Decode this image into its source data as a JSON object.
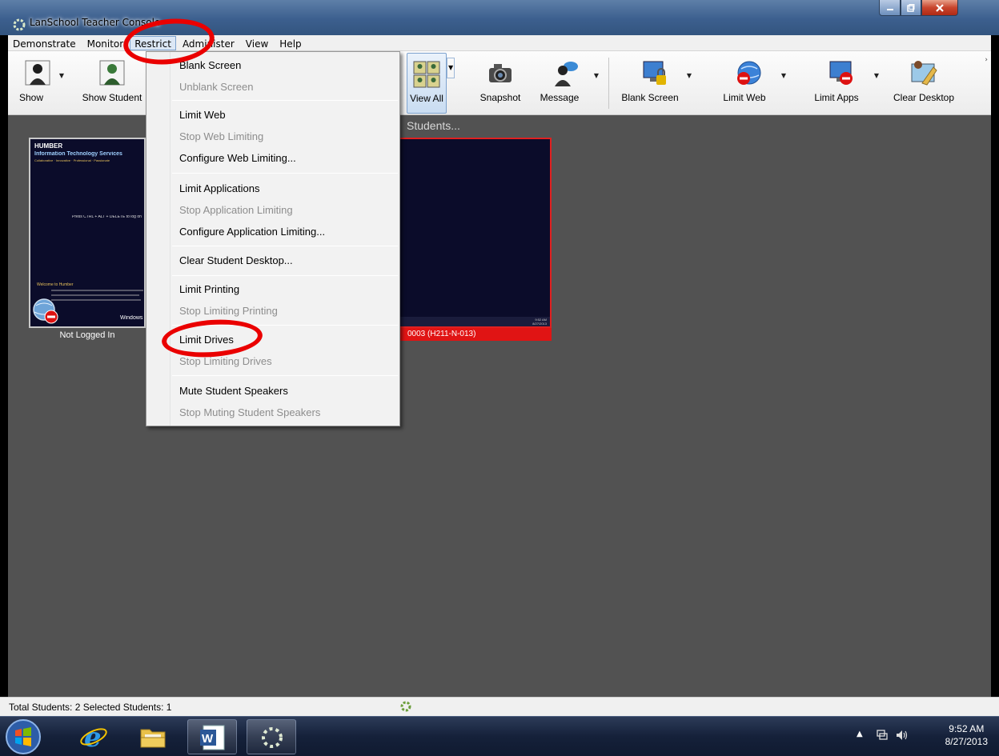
{
  "window": {
    "title": "LanSchool Teacher Console",
    "controls": {
      "minimize": "minimize",
      "maximize": "maximize",
      "close": "close"
    }
  },
  "menubar": [
    {
      "label": "Demonstrate"
    },
    {
      "label": "Monitor"
    },
    {
      "label": "Restrict",
      "active": true
    },
    {
      "label": "Administer"
    },
    {
      "label": "View"
    },
    {
      "label": "Help"
    }
  ],
  "toolbar": {
    "show": "Show",
    "show_student": "Show Student",
    "view_all": "View All",
    "snapshot": "Snapshot",
    "message": "Message",
    "blank_screen": "Blank Screen",
    "limit_web": "Limit Web",
    "limit_apps": "Limit Apps",
    "clear_desktop": "Clear Desktop"
  },
  "main": {
    "heading": "Students...",
    "thumbnails": [
      {
        "label": "Not Logged In",
        "brand": "HUMBER",
        "line1": "Information Technology Services",
        "line2": "Collaborative · Innovative · Professional · Passionate",
        "center": "Press CTRL + ALT + DELETE to log on",
        "welcome": "Welcome to Humber",
        "os": "Windows 7"
      },
      {
        "label": "0003 (H211-N-013)",
        "clock": "9:52 AM 8/27/2013"
      }
    ]
  },
  "dropdown": {
    "items": [
      {
        "label": "Blank Screen",
        "enabled": true
      },
      {
        "label": "Unblank Screen",
        "enabled": false
      },
      {
        "label": "Limit Web",
        "enabled": true
      },
      {
        "label": "Stop Web Limiting",
        "enabled": false
      },
      {
        "label": "Configure Web Limiting...",
        "enabled": true
      },
      {
        "label": "Limit Applications",
        "enabled": true
      },
      {
        "label": "Stop Application Limiting",
        "enabled": false
      },
      {
        "label": "Configure Application Limiting...",
        "enabled": true
      },
      {
        "label": "Clear Student Desktop...",
        "enabled": true
      },
      {
        "label": "Limit Printing",
        "enabled": true
      },
      {
        "label": "Stop Limiting Printing",
        "enabled": false
      },
      {
        "label": "Limit Drives",
        "enabled": true
      },
      {
        "label": "Stop Limiting Drives",
        "enabled": false
      },
      {
        "label": "Mute Student Speakers",
        "enabled": true
      },
      {
        "label": "Stop Muting Student Speakers",
        "enabled": false
      }
    ]
  },
  "statusbar": {
    "text": "Total Students: 2  Selected Students: 1"
  },
  "taskbar": {
    "apps": [
      "start-orb",
      "internet-explorer",
      "file-explorer",
      "microsoft-word",
      "lanschool"
    ],
    "time": "9:52 AM",
    "date": "8/27/2013"
  },
  "colors": {
    "annotation": "#ea0000",
    "main_bg": "#525252",
    "selected_border": "#e02020"
  }
}
